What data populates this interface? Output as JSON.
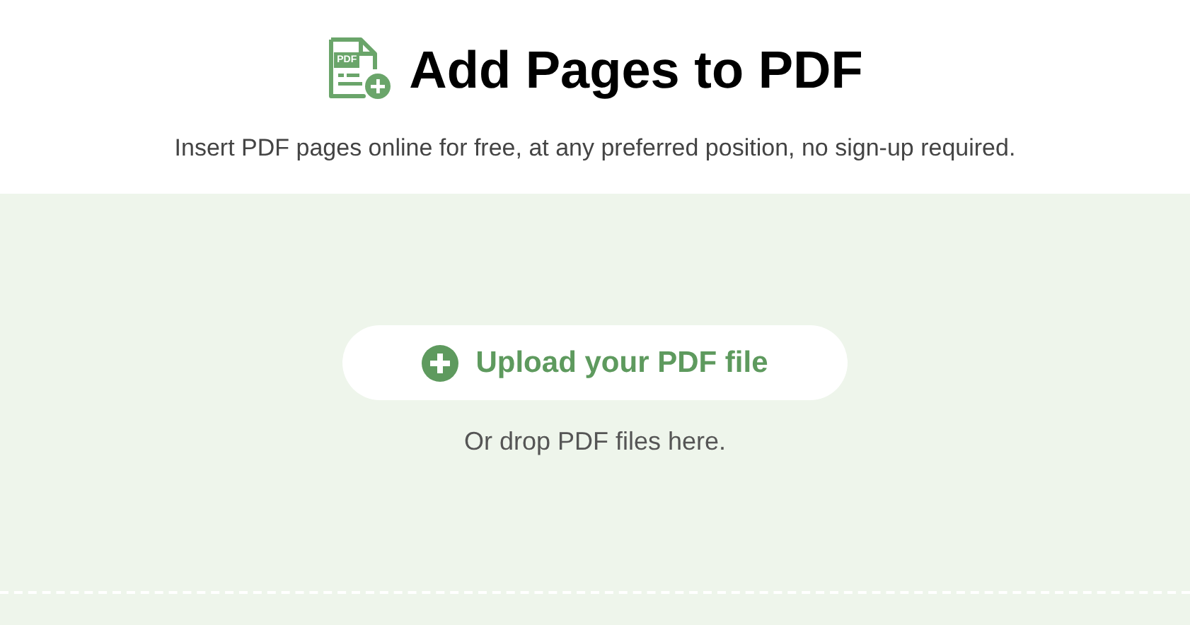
{
  "header": {
    "icon_tag": "PDF",
    "title": "Add Pages to PDF",
    "subtitle": "Insert PDF pages online for free, at any preferred position, no sign-up required."
  },
  "dropzone": {
    "button": "Upload your PDF file",
    "hint": "Or drop PDF files here."
  }
}
